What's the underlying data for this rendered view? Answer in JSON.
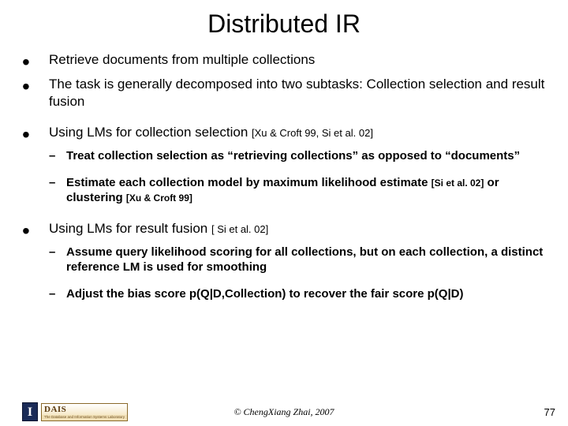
{
  "title": "Distributed IR",
  "bullets": [
    {
      "text": "Retrieve documents from multiple collections"
    },
    {
      "text": "The task is generally decomposed into two subtasks: Collection selection and result fusion"
    },
    {
      "text": "Using LMs for collection selection ",
      "cite": "[Xu &  Croft 99, Si et al. 02]",
      "sub": [
        {
          "text": "Treat collection selection as “retrieving collections” as opposed to “documents”"
        },
        {
          "pre": "Estimate each collection model by maximum likelihood estimate ",
          "cite1": "[Si et al. 02]",
          "mid": " or clustering ",
          "cite2": "[Xu & Croft 99]"
        }
      ]
    },
    {
      "text": "Using LMs for result fusion ",
      "cite": "[ Si et al. 02]",
      "sub": [
        {
          "text": "Assume query likelihood scoring for all collections, but on each collection, a distinct reference LM is used for smoothing"
        },
        {
          "text": "Adjust the bias score p(Q|D,Collection) to recover the fair score p(Q|D)"
        }
      ]
    }
  ],
  "footer": {
    "logo_i": "I",
    "logo_dais": "DAIS",
    "logo_sub": "The Database and Information Systems Laboratory",
    "copyright": "© ChengXiang Zhai, 2007",
    "page": "77"
  }
}
